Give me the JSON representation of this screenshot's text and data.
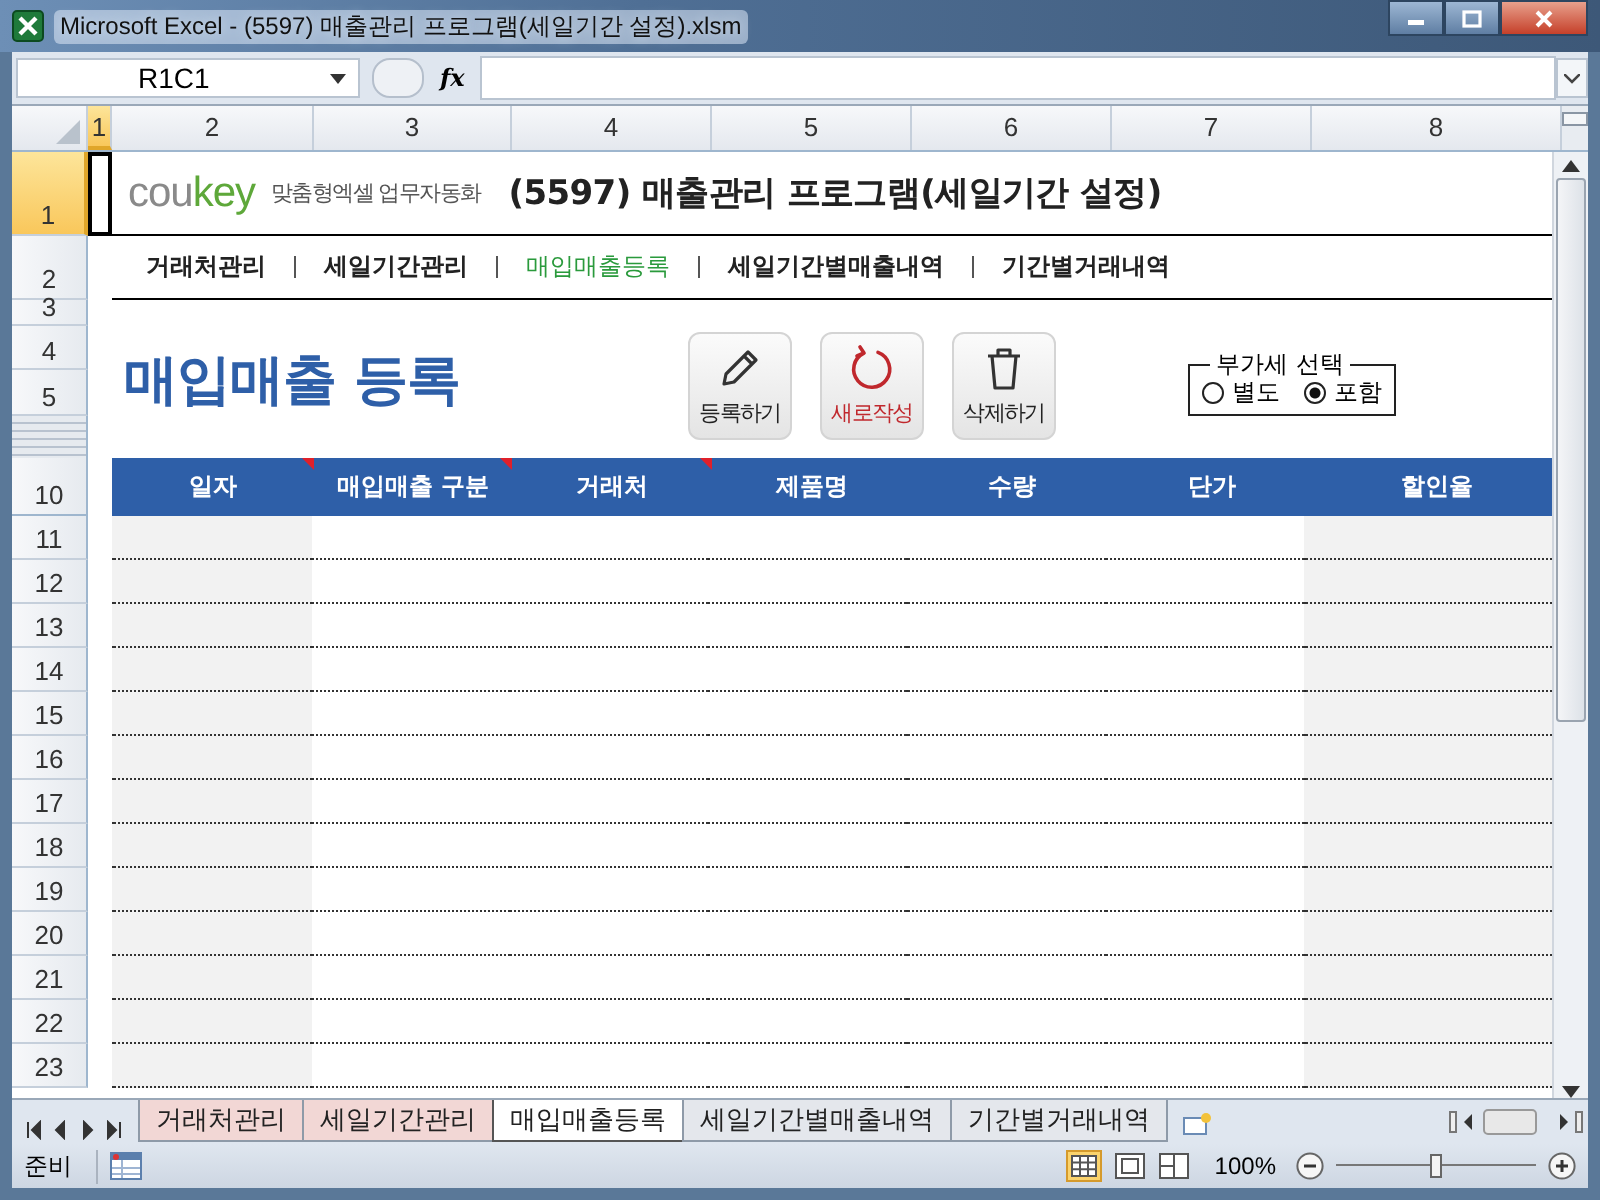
{
  "window": {
    "title": "Microsoft Excel - (5597) 매출관리 프로그램(세일기간 설정).xlsm"
  },
  "formula_bar": {
    "name_box": "R1C1",
    "fx_label": "fx"
  },
  "column_headers": [
    {
      "label": "1",
      "selected": true
    },
    {
      "label": "2",
      "selected": false
    },
    {
      "label": "3",
      "selected": false
    },
    {
      "label": "4",
      "selected": false
    },
    {
      "label": "5",
      "selected": false
    },
    {
      "label": "6",
      "selected": false
    },
    {
      "label": "7",
      "selected": false
    },
    {
      "label": "8",
      "selected": false
    }
  ],
  "header": {
    "logo_prefix": "cou",
    "logo_suffix": "key",
    "tagline": "맞춤형엑셀 업무자동화",
    "title": "(5597) 매출관리 프로그램(세일기간 설정)"
  },
  "nav": [
    {
      "label": "거래처관리",
      "selected": false
    },
    {
      "label": "세일기간관리",
      "selected": false
    },
    {
      "label": "매입매출등록",
      "selected": true
    },
    {
      "label": "세일기간별매출내역",
      "selected": false
    },
    {
      "label": "기간별거래내역",
      "selected": false
    }
  ],
  "section_rows": [
    {
      "label": "1",
      "selected": true
    },
    {
      "label": "2",
      "selected": false
    },
    {
      "label": "3",
      "selected": false
    },
    {
      "label": "4",
      "selected": false
    },
    {
      "label": "5",
      "selected": false
    }
  ],
  "page_heading": "매입매출 등록",
  "actions": [
    {
      "kind": "pencil",
      "label": "등록하기"
    },
    {
      "kind": "refresh",
      "label": "새로작성"
    },
    {
      "kind": "trash",
      "label": "삭제하기"
    }
  ],
  "vat": {
    "legend": "부가세 선택",
    "options": [
      {
        "label": "별도",
        "selected": false
      },
      {
        "label": "포함",
        "selected": true
      }
    ]
  },
  "table": {
    "row_label": "10",
    "columns": [
      {
        "label": "일자",
        "comment": true
      },
      {
        "label": "매입매출 구분",
        "comment": true
      },
      {
        "label": "거래처",
        "comment": true
      },
      {
        "label": "제품명",
        "comment": false
      },
      {
        "label": "수량",
        "comment": false
      },
      {
        "label": "단가",
        "comment": false
      },
      {
        "label": "할인율",
        "comment": false
      }
    ],
    "rows": [
      "11",
      "12",
      "13",
      "14",
      "15",
      "16",
      "17",
      "18",
      "19",
      "20",
      "21",
      "22",
      "23"
    ]
  },
  "sheet_tabs": [
    {
      "label": "거래처관리",
      "selected": false,
      "color": "#f2d7d5"
    },
    {
      "label": "세일기간관리",
      "selected": false,
      "color": "#f2d7d5"
    },
    {
      "label": "매입매출등록",
      "selected": true
    },
    {
      "label": "세일기간별매출내역",
      "selected": false
    },
    {
      "label": "기간별거래내역",
      "selected": false
    }
  ],
  "status_bar": {
    "status": "준비",
    "zoom": "100%",
    "zoom_level": {
      "level": 0.5
    }
  }
}
